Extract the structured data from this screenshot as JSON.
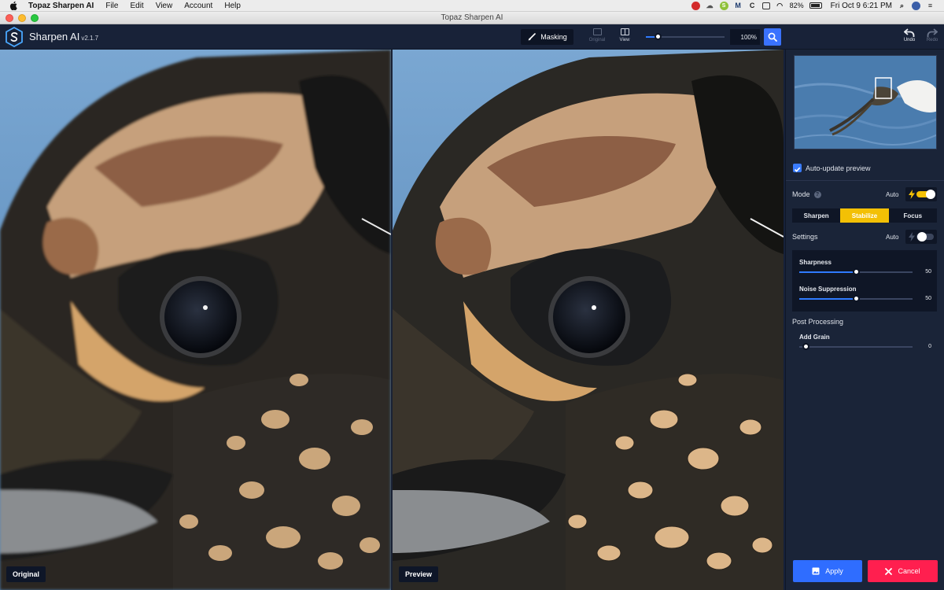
{
  "menubar": {
    "app_name": "Topaz Sharpen AI",
    "items": [
      "File",
      "Edit",
      "View",
      "Account",
      "Help"
    ],
    "battery": "82%",
    "clock": "Fri Oct 9  6:21 PM"
  },
  "window": {
    "title": "Topaz Sharpen AI"
  },
  "header": {
    "app_title": "Sharpen AI",
    "version": "v2.1.7",
    "masking_label": "Masking",
    "original_label": "Original",
    "view_label": "View",
    "zoom_value": "100%",
    "zoom_level": 0.15,
    "undo_label": "Undo",
    "redo_label": "Redo"
  },
  "panes": {
    "left_tag": "Original",
    "right_tag": "Preview"
  },
  "panel": {
    "auto_update_label": "Auto-update preview",
    "mode_label": "Mode",
    "mode_auto_label": "Auto",
    "modes": [
      "Sharpen",
      "Stabilize",
      "Focus"
    ],
    "active_mode": "Stabilize",
    "settings_label": "Settings",
    "settings_auto_label": "Auto",
    "sliders": [
      {
        "label": "Sharpness",
        "value": 50
      },
      {
        "label": "Noise Suppression",
        "value": 50
      }
    ],
    "post_label": "Post Processing",
    "grain_label": "Add Grain",
    "grain_value": 0,
    "apply_label": "Apply",
    "cancel_label": "Cancel"
  },
  "colors": {
    "accent_blue": "#2f6dff",
    "accent_yellow": "#f3c005",
    "cancel_red": "#ff1f4f",
    "panel_bg": "#1a2438"
  }
}
